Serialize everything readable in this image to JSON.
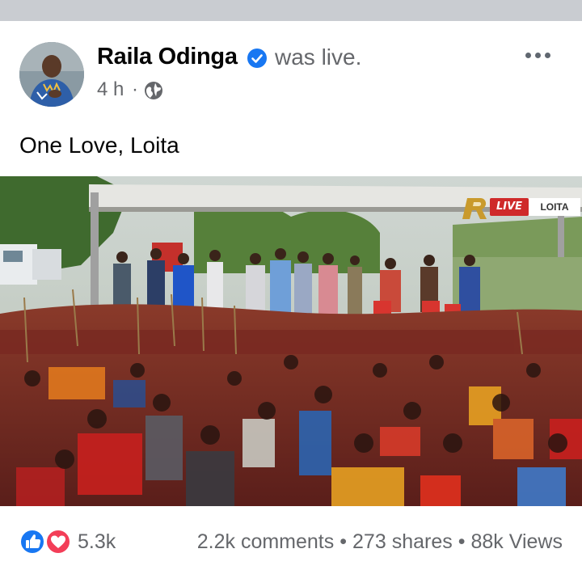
{
  "post": {
    "author": "Raila Odinga",
    "status": "was live.",
    "time": "4 h",
    "separator": "·",
    "caption": "One Love, Loita",
    "live_badge": {
      "live": "LIVE",
      "location": "LOITA"
    }
  },
  "engagement": {
    "reaction_count": "5.3k",
    "comments": "2.2k comments",
    "shares": "273 shares",
    "views": "88k Views",
    "separator": "•"
  },
  "colors": {
    "verified": "#1877f2",
    "like": "#1877f2",
    "love": "#f33e58",
    "live_red": "#cf2a2a",
    "muted_text": "#65676b"
  },
  "icons": [
    "verified-badge-icon",
    "globe-icon",
    "more-options-icon",
    "like-reaction-icon",
    "love-reaction-icon"
  ]
}
